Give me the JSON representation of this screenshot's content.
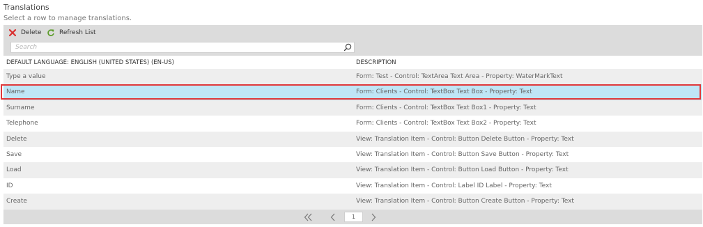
{
  "header": {
    "title": "Translations",
    "subtitle": "Select a row to manage translations."
  },
  "toolbar": {
    "delete_label": "Delete",
    "delete_icon": "close-icon",
    "refresh_label": "Refresh List",
    "refresh_icon": "refresh-icon"
  },
  "search": {
    "placeholder": "Search",
    "value": "",
    "icon": "search-icon"
  },
  "grid": {
    "columns": [
      "DEFAULT LANGUAGE: ENGLISH (UNITED STATES) (EN-US)",
      "DESCRIPTION"
    ],
    "selected_index": 1,
    "rows": [
      {
        "default": "Type a value",
        "description": "Form: Test - Control: TextArea Text Area - Property: WaterMarkText"
      },
      {
        "default": "Name",
        "description": "Form: Clients - Control: TextBox Text Box - Property: Text"
      },
      {
        "default": "Surname",
        "description": "Form: Clients - Control: TextBox Text Box1 - Property: Text"
      },
      {
        "default": "Telephone",
        "description": "Form: Clients - Control: TextBox Text Box2 - Property: Text"
      },
      {
        "default": "Delete",
        "description": "View: Translation Item - Control: Button Delete Button - Property: Text"
      },
      {
        "default": "Save",
        "description": "View: Translation Item - Control: Button Save Button - Property: Text"
      },
      {
        "default": "Load",
        "description": "View: Translation Item - Control: Button Load Button - Property: Text"
      },
      {
        "default": "ID",
        "description": "View: Translation Item - Control: Label ID Label - Property: Text"
      },
      {
        "default": "Create",
        "description": "View: Translation Item - Control: Button Create Button - Property: Text"
      }
    ]
  },
  "pager": {
    "current_page": "1",
    "first_icon": "double-chevron-left-icon",
    "prev_icon": "chevron-left-icon",
    "next_icon": "chevron-right-icon"
  },
  "colors": {
    "toolbar_bg": "#dcdcdc",
    "selected_row_bg": "#bfe6f6",
    "selection_outline": "#e0383a",
    "alt_row_bg": "#eeeeee",
    "delete_icon": "#d93030",
    "refresh_icon": "#5c9c2a"
  }
}
